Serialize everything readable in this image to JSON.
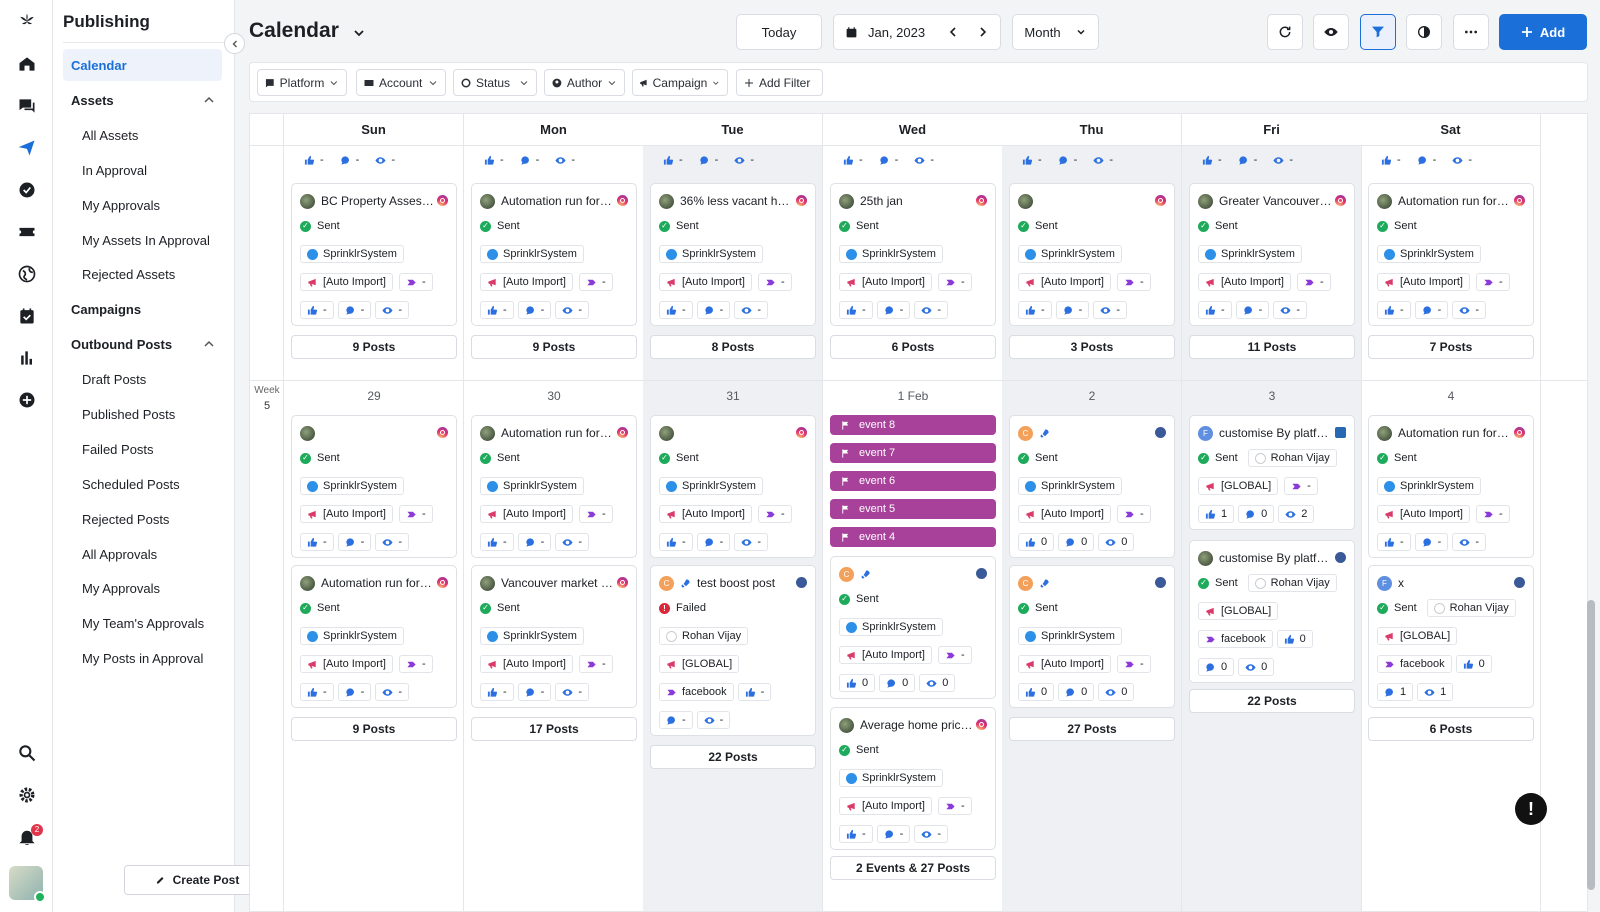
{
  "app": {
    "section_title": "Publishing",
    "page_title": "Calendar",
    "notification_count": "2",
    "accent": "#1a6fd8"
  },
  "rail": {
    "icons": [
      "sprinklr-logo-icon",
      "home-icon",
      "chat-icon",
      "send-icon",
      "check-circle-icon",
      "ticket-icon",
      "globe-icon",
      "calendar-check-icon",
      "bar-chart-icon",
      "plus-circle-icon",
      "search-icon",
      "gear-icon",
      "bell-icon"
    ]
  },
  "sidebar": {
    "items": [
      {
        "label": "Calendar",
        "type": "active"
      },
      {
        "label": "Assets",
        "type": "sec",
        "chevron": true
      },
      {
        "label": "All Assets",
        "type": "sub"
      },
      {
        "label": "In Approval",
        "type": "sub"
      },
      {
        "label": "My Approvals",
        "type": "sub"
      },
      {
        "label": "My Assets In Approval",
        "type": "sub"
      },
      {
        "label": "Rejected Assets",
        "type": "sub"
      },
      {
        "label": "Campaigns",
        "type": "sec"
      },
      {
        "label": "Outbound Posts",
        "type": "sec",
        "chevron": true
      },
      {
        "label": "Draft Posts",
        "type": "sub"
      },
      {
        "label": "Published Posts",
        "type": "sub"
      },
      {
        "label": "Failed Posts",
        "type": "sub"
      },
      {
        "label": "Scheduled Posts",
        "type": "sub"
      },
      {
        "label": "Rejected Posts",
        "type": "sub"
      },
      {
        "label": "All Approvals",
        "type": "sub"
      },
      {
        "label": "My Approvals",
        "type": "sub"
      },
      {
        "label": "My Team's Approvals",
        "type": "sub"
      },
      {
        "label": "My Posts in Approval",
        "type": "sub"
      }
    ],
    "create_post": "Create Post"
  },
  "toolbar": {
    "today": "Today",
    "date": "Jan, 2023",
    "view": "Month",
    "add": "Add"
  },
  "filters": [
    {
      "label": "Platform",
      "icon": "platform-icon"
    },
    {
      "label": "Account",
      "icon": "account-icon"
    },
    {
      "label": "Status",
      "icon": "status-icon"
    },
    {
      "label": "Author",
      "icon": "author-icon"
    },
    {
      "label": "Campaign",
      "icon": "megaphone-icon"
    }
  ],
  "add_filter": "Add Filter",
  "days": [
    "Sun",
    "Mon",
    "Tue",
    "Wed",
    "Thu",
    "Fri",
    "Sat"
  ],
  "shaded_days": [
    2,
    4,
    5
  ],
  "week4": {
    "partial_metric": "-",
    "cards": [
      {
        "title": "BC Property Assess...",
        "platform": "ig",
        "status": "Sent",
        "user": "SprinklrSystem",
        "campaign": "[Auto Import]",
        "campaign_value": "-",
        "likes": "-",
        "comments": "-",
        "views": "-"
      },
      {
        "title": "Automation run for l...",
        "platform": "ig",
        "status": "Sent",
        "user": "SprinklrSystem",
        "campaign": "[Auto Import]",
        "campaign_value": "-",
        "likes": "-",
        "comments": "-",
        "views": "-"
      },
      {
        "title": "36% less vacant ho...",
        "platform": "ig",
        "status": "Sent",
        "user": "SprinklrSystem",
        "campaign": "[Auto Import]",
        "campaign_value": "-",
        "likes": "-",
        "comments": "-",
        "views": "-"
      },
      {
        "title": "25th jan",
        "platform": "ig",
        "status": "Sent",
        "user": "SprinklrSystem",
        "campaign": "[Auto Import]",
        "campaign_value": "-",
        "likes": "-",
        "comments": "-",
        "views": "-"
      },
      {
        "title": "",
        "platform": "ig",
        "status": "Sent",
        "user": "SprinklrSystem",
        "campaign": "[Auto Import]",
        "campaign_value": "-",
        "likes": "-",
        "comments": "-",
        "views": "-"
      },
      {
        "title": "Greater Vancouver ...",
        "platform": "ig",
        "status": "Sent",
        "user": "SprinklrSystem",
        "campaign": "[Auto Import]",
        "campaign_value": "-",
        "likes": "-",
        "comments": "-",
        "views": "-"
      },
      {
        "title": "Automation run for l...",
        "platform": "ig",
        "status": "Sent",
        "user": "SprinklrSystem",
        "campaign": "[Auto Import]",
        "campaign_value": "-",
        "likes": "-",
        "comments": "-",
        "views": "-"
      }
    ],
    "counts": [
      "9 Posts",
      "9 Posts",
      "8 Posts",
      "6 Posts",
      "3 Posts",
      "11 Posts",
      "7 Posts"
    ]
  },
  "week5": {
    "label": "Week",
    "number": "5",
    "dates": [
      "29",
      "30",
      "31",
      "1 Feb",
      "2",
      "3",
      "4"
    ],
    "events": [
      "event 8",
      "event 7",
      "event 6",
      "event 5",
      "event 4"
    ],
    "counts": [
      "9 Posts",
      "17 Posts",
      "22 Posts",
      "2 Events & 27 Posts",
      "27 Posts",
      "22 Posts",
      "6 Posts"
    ],
    "cards": {
      "sun1": {
        "title": "",
        "platform": "ig",
        "status": "Sent",
        "user": "SprinklrSystem",
        "campaign": "[Auto Import]",
        "campaign_value": "-",
        "likes": "-",
        "comments": "-",
        "views": "-"
      },
      "sun2": {
        "title": "Automation run for l...",
        "platform": "ig",
        "status": "Sent",
        "user": "SprinklrSystem",
        "campaign": "[Auto Import]",
        "campaign_value": "-",
        "likes": "-",
        "comments": "-",
        "views": "-"
      },
      "mon1": {
        "title": "Automation run for l...",
        "platform": "ig",
        "status": "Sent",
        "user": "SprinklrSystem",
        "campaign": "[Auto Import]",
        "campaign_value": "-",
        "likes": "-",
        "comments": "-",
        "views": "-"
      },
      "mon2": {
        "title": "Vancouver market t...",
        "platform": "ig",
        "status": "Sent",
        "user": "SprinklrSystem",
        "campaign": "[Auto Import]",
        "campaign_value": "-",
        "likes": "-",
        "comments": "-",
        "views": "-"
      },
      "tue1": {
        "title": "",
        "platform": "ig",
        "status": "Sent",
        "user": "SprinklrSystem",
        "campaign": "[Auto Import]",
        "campaign_value": "-",
        "likes": "-",
        "comments": "-",
        "views": "-"
      },
      "tue2": {
        "title": "test boost post",
        "avatar": "C",
        "status": "Failed",
        "user": "Rohan Vijay",
        "campaign": "[GLOBAL]",
        "network": "facebook",
        "likes": "-",
        "comments": "-",
        "views": "-"
      },
      "wed1": {
        "title": "",
        "avatar": "C",
        "status": "Sent",
        "user": "SprinklrSystem",
        "campaign": "[Auto Import]",
        "campaign_value": "-",
        "likes": "0",
        "comments": "0",
        "views": "0"
      },
      "wed2": {
        "title": "Average home price ...",
        "platform": "ig",
        "status": "Sent",
        "user": "SprinklrSystem",
        "campaign": "[Auto Import]",
        "campaign_value": "-",
        "likes": "-",
        "comments": "-",
        "views": "-"
      },
      "thu1": {
        "title": "",
        "avatar": "C",
        "status": "Sent",
        "user": "SprinklrSystem",
        "campaign": "[Auto Import]",
        "campaign_value": "-",
        "likes": "0",
        "comments": "0",
        "views": "0"
      },
      "thu2": {
        "title": "",
        "avatar": "C",
        "status": "Sent",
        "user": "SprinklrSystem",
        "campaign": "[Auto Import]",
        "campaign_value": "-",
        "likes": "0",
        "comments": "0",
        "views": "0"
      },
      "fri1": {
        "title": "customise By platfor...",
        "avatar": "F",
        "status": "Sent",
        "user2": "Rohan Vijay",
        "campaign": "[GLOBAL]",
        "campaign_value": "-",
        "likes": "1",
        "comments": "0",
        "views": "2"
      },
      "fri2": {
        "title": "customise By platfor...",
        "status": "Sent",
        "user2": "Rohan Vijay",
        "campaign": "[GLOBAL]",
        "network": "facebook",
        "likes": "0",
        "comments": "0",
        "views": "0"
      },
      "sat1": {
        "title": "Automation run for l...",
        "platform": "ig",
        "status": "Sent",
        "user": "SprinklrSystem",
        "campaign": "[Auto Import]",
        "campaign_value": "-",
        "likes": "-",
        "comments": "-",
        "views": "-"
      },
      "sat2": {
        "title": "x",
        "avatar": "F",
        "status": "Sent",
        "user2": "Rohan Vijay",
        "campaign": "[GLOBAL]",
        "network": "facebook",
        "likes": "0",
        "comments": "1",
        "views": "1"
      }
    }
  },
  "help": "!"
}
